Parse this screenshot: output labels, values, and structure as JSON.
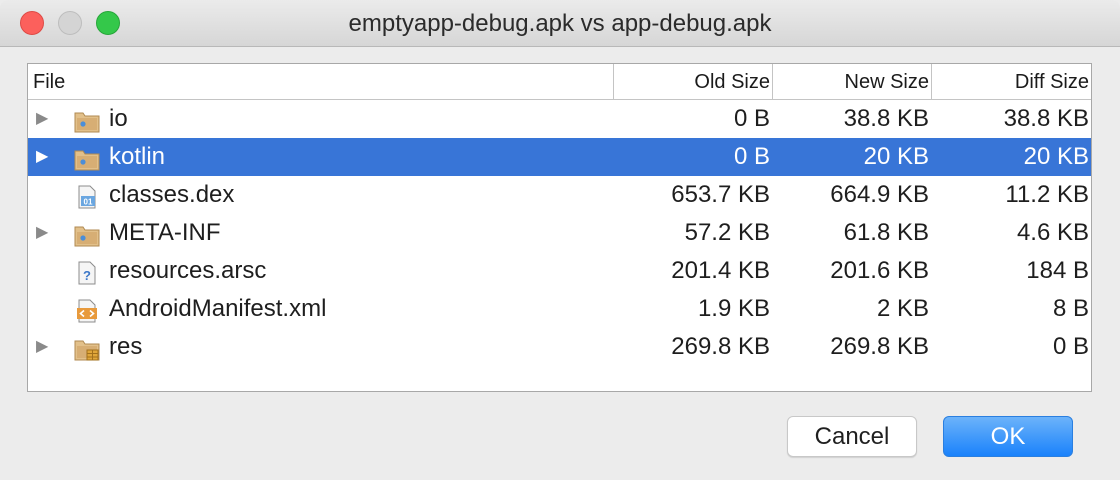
{
  "window": {
    "title": "emptyapp-debug.apk vs app-debug.apk"
  },
  "table": {
    "headers": {
      "file": "File",
      "old": "Old Size",
      "new": "New Size",
      "diff": "Diff Size"
    },
    "rows": [
      {
        "name": "io",
        "icon": "folder-icon",
        "expandable": true,
        "selected": false,
        "old": "0 B",
        "new": "38.8 KB",
        "diff": "38.8 KB"
      },
      {
        "name": "kotlin",
        "icon": "folder-icon",
        "expandable": true,
        "selected": true,
        "old": "0 B",
        "new": "20 KB",
        "diff": "20 KB"
      },
      {
        "name": "classes.dex",
        "icon": "dex-file-icon",
        "expandable": false,
        "selected": false,
        "old": "653.7 KB",
        "new": "664.9 KB",
        "diff": "11.2 KB"
      },
      {
        "name": "META-INF",
        "icon": "folder-icon",
        "expandable": true,
        "selected": false,
        "old": "57.2 KB",
        "new": "61.8 KB",
        "diff": "4.6 KB"
      },
      {
        "name": "resources.arsc",
        "icon": "unknown-file-icon",
        "expandable": false,
        "selected": false,
        "old": "201.4 KB",
        "new": "201.6 KB",
        "diff": "184 B"
      },
      {
        "name": "AndroidManifest.xml",
        "icon": "xml-file-icon",
        "expandable": false,
        "selected": false,
        "old": "1.9 KB",
        "new": "2 KB",
        "diff": "8 B"
      },
      {
        "name": "res",
        "icon": "resource-folder-icon",
        "expandable": true,
        "selected": false,
        "old": "269.8 KB",
        "new": "269.8 KB",
        "diff": "0 B"
      }
    ]
  },
  "buttons": {
    "cancel": "Cancel",
    "ok": "OK"
  },
  "colors": {
    "selection": "#3875d7",
    "ok_button": "#1a82fb",
    "folder": "#c9a16a"
  }
}
